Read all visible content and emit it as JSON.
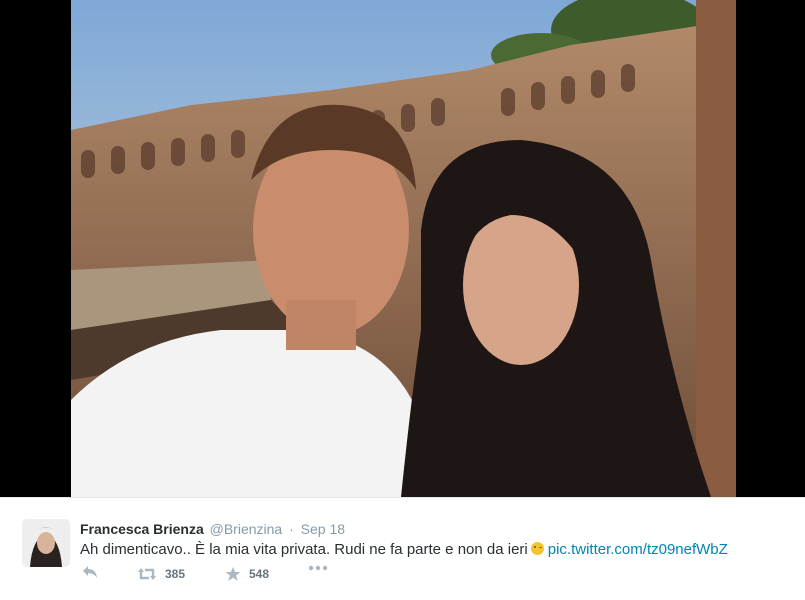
{
  "tweet": {
    "fullname": "Francesca Brienza",
    "username": "@Brienzina",
    "separator": "·",
    "timestamp": "Sep 18",
    "text": "Ah dimenticavo.. È la mia vita privata. Rudi ne fa parte e non da ieri",
    "emoji": "winking-face",
    "link": "pic.twitter.com/tz09nefWbZ",
    "retweet_count": "385",
    "favorite_count": "548"
  },
  "icons": {
    "reply": "reply-icon",
    "retweet": "retweet-icon",
    "favorite": "star-icon",
    "more": "more-icon"
  },
  "colors": {
    "link": "#0084b4",
    "name": "#292f33",
    "meta": "#8899a6",
    "backdrop": "#000000"
  }
}
